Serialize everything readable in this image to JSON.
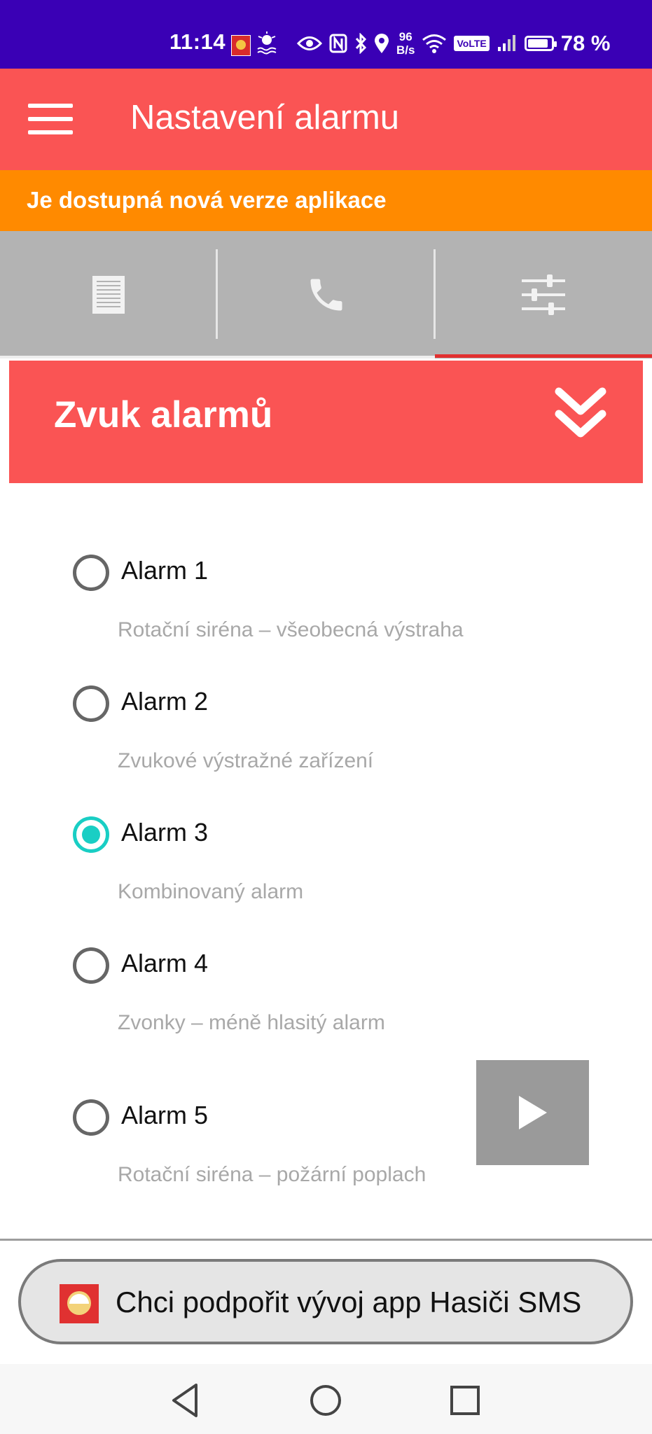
{
  "status_bar": {
    "time": "11:14",
    "speed_value": "96",
    "speed_unit": "B/s",
    "volte": "VoLTE",
    "battery": "78 %",
    "icons": [
      "app-notification-icon",
      "alarm-icon",
      "eye-icon",
      "nfc-icon",
      "bluetooth-icon",
      "location-icon",
      "wifi-icon",
      "signal-icon",
      "battery-icon"
    ]
  },
  "app_bar": {
    "title": "Nastavení alarmu",
    "menu_icon": "hamburger-menu-icon"
  },
  "update_banner": {
    "text": "Je dostupná nová verze aplikace"
  },
  "tabs": [
    {
      "icon": "document-icon",
      "selected": false
    },
    {
      "icon": "phone-icon",
      "selected": false
    },
    {
      "icon": "sliders-icon",
      "selected": true
    }
  ],
  "section": {
    "title": "Zvuk alarmů",
    "chevron_icon": "double-chevron-down-icon"
  },
  "alarms": [
    {
      "label": "Alarm 1",
      "description": "Rotační siréna – všeobecná výstraha",
      "checked": false
    },
    {
      "label": "Alarm 2",
      "description": "Zvukové výstražné zařízení",
      "checked": false
    },
    {
      "label": "Alarm 3",
      "description": "Kombinovaný alarm",
      "checked": true
    },
    {
      "label": "Alarm 4",
      "description": "Zvonky – méně hlasitý alarm",
      "checked": false
    },
    {
      "label": "Alarm 5",
      "description": "Rotační siréna – požární poplach",
      "checked": false
    }
  ],
  "play_button": {
    "icon": "play-icon"
  },
  "support_button": {
    "text": "Chci podpořit vývoj app Hasiči SMS",
    "icon": "hasici-sms-logo-icon"
  },
  "nav_bar": {
    "buttons": [
      "back-icon",
      "home-icon",
      "recents-icon"
    ]
  },
  "colors": {
    "status_bar": "#3a00b5",
    "app_bar": "#fa5454",
    "banner": "#ff8a00",
    "tab_bar": "#b3b3b3",
    "radio_checked": "#19cec4",
    "tab_indicator": "#e23030"
  }
}
